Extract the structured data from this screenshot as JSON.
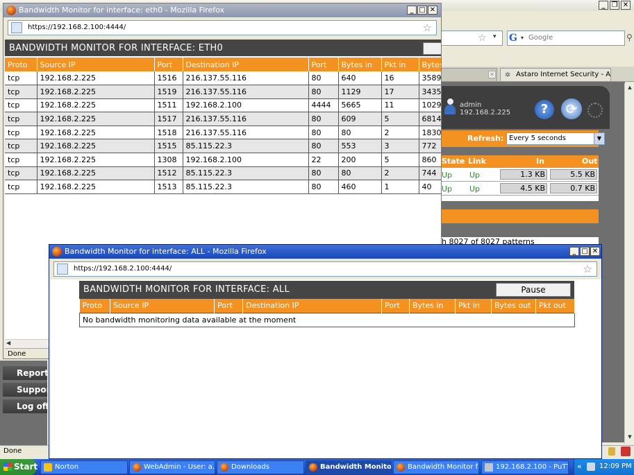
{
  "background_browser": {
    "google_placeholder": "Google",
    "tab": {
      "title": "Astaro Internet Security - All..."
    },
    "user": {
      "name": "admin",
      "ip": "192.168.2.225"
    },
    "refresh": {
      "label": "Refresh:",
      "value": "Every 5 seconds"
    },
    "interfaces": {
      "headers": [
        "State",
        "Link",
        "In",
        "Out"
      ],
      "rows": [
        {
          "state": "Up",
          "link": "Up",
          "in": "1.3 KB",
          "out": "5.5 KB"
        },
        {
          "state": "Up",
          "link": "Up",
          "in": "4.5 KB",
          "out": "0.7 KB"
        }
      ]
    },
    "patterns_text": "h 8027 of 8027 patterns",
    "left_nav": [
      "Reporting",
      "Support",
      "Log off"
    ],
    "status": "Done"
  },
  "window_eth0": {
    "title": "Bandwidth Monitor for interface: eth0 - Mozilla Firefox",
    "url": "https://192.168.2.100:4444/",
    "heading": "BANDWIDTH MONITOR FOR INTERFACE: ETH0",
    "columns": [
      "Proto",
      "Source IP",
      "Port",
      "Destination IP",
      "Port",
      "Bytes in",
      "Pkt in",
      "Bytes"
    ],
    "rows": [
      [
        "tcp",
        "192.168.2.225",
        "1516",
        "216.137.55.116",
        "80",
        "640",
        "16",
        "3589"
      ],
      [
        "tcp",
        "192.168.2.225",
        "1519",
        "216.137.55.116",
        "80",
        "1129",
        "17",
        "3435"
      ],
      [
        "tcp",
        "192.168.2.225",
        "1511",
        "192.168.2.100",
        "4444",
        "5665",
        "11",
        "1029"
      ],
      [
        "tcp",
        "192.168.2.225",
        "1517",
        "216.137.55.116",
        "80",
        "609",
        "5",
        "6814"
      ],
      [
        "tcp",
        "192.168.2.225",
        "1518",
        "216.137.55.116",
        "80",
        "80",
        "2",
        "1830"
      ],
      [
        "tcp",
        "192.168.2.225",
        "1515",
        "85.115.22.3",
        "80",
        "553",
        "3",
        "772"
      ],
      [
        "tcp",
        "192.168.2.225",
        "1308",
        "192.168.2.100",
        "22",
        "200",
        "5",
        "860"
      ],
      [
        "tcp",
        "192.168.2.225",
        "1512",
        "85.115.22.3",
        "80",
        "80",
        "2",
        "744"
      ],
      [
        "tcp",
        "192.168.2.225",
        "1513",
        "85.115.22.3",
        "80",
        "460",
        "1",
        "40"
      ]
    ],
    "status": "Done"
  },
  "window_all": {
    "title": "Bandwidth Monitor for interface: ALL - Mozilla Firefox",
    "url": "https://192.168.2.100:4444/",
    "heading": "BANDWIDTH MONITOR FOR INTERFACE: ALL",
    "pause_label": "Pause",
    "columns": [
      "Proto",
      "Source IP",
      "Port",
      "Destination IP",
      "Port",
      "Bytes in",
      "Pkt in",
      "Bytes out",
      "Pkt out"
    ],
    "empty_message": "No bandwidth monitoring data available at the moment"
  },
  "taskbar": {
    "start_label": "Start",
    "tasks": [
      {
        "label": "Norton",
        "icon": "norton-icon"
      },
      {
        "label": "WebAdmin - User: a...",
        "icon": "firefox-icon"
      },
      {
        "label": "Downloads",
        "icon": "firefox-icon"
      },
      {
        "label": "Bandwidth Monito...",
        "icon": "firefox-icon",
        "active": true
      },
      {
        "label": "Bandwidth Monitor f...",
        "icon": "firefox-icon"
      },
      {
        "label": "192.168.2.100 - PuTTY",
        "icon": "putty-icon"
      }
    ],
    "clock": "12:09 PM"
  },
  "colors": {
    "accent_orange": "#f39220",
    "header_dark": "#454545",
    "xp_blue": "#245edb",
    "status_green": "#1a9a1a"
  }
}
